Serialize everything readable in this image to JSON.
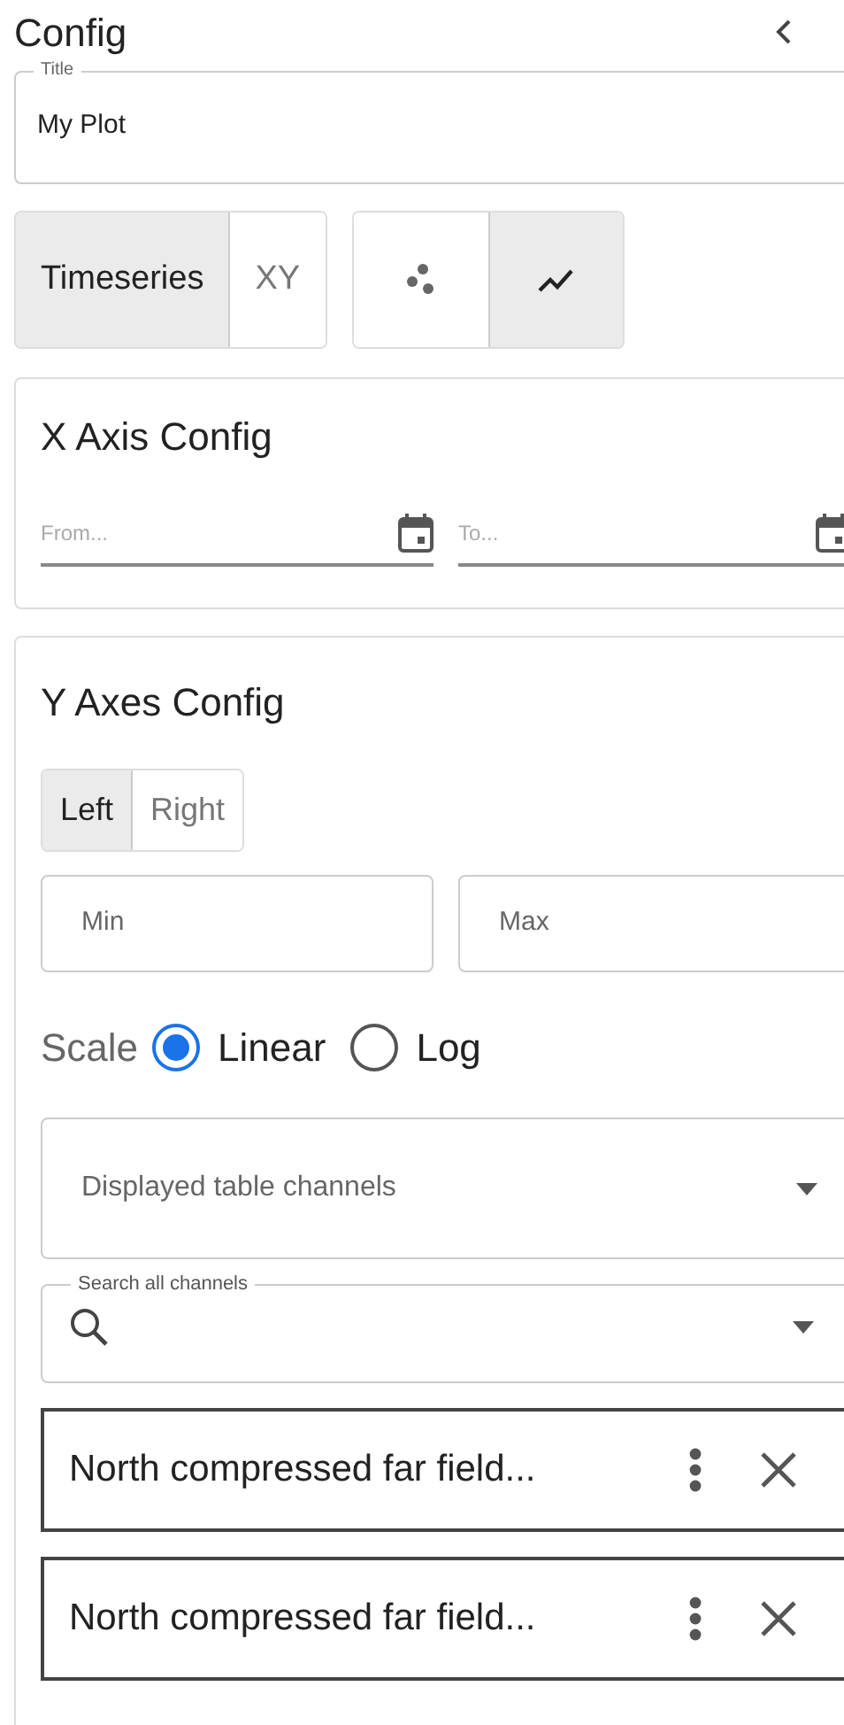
{
  "header": {
    "title": "Config"
  },
  "title_field": {
    "label": "Title",
    "value": "My Plot"
  },
  "plot_types": [
    {
      "label": "Timeseries",
      "selected": true
    },
    {
      "label": "XY",
      "selected": false
    }
  ],
  "plot_styles": [
    {
      "kind": "scatter",
      "selected": false
    },
    {
      "kind": "line",
      "selected": true
    }
  ],
  "x_axis": {
    "title": "X Axis Config",
    "from": {
      "placeholder": "From..."
    },
    "to": {
      "placeholder": "To..."
    }
  },
  "y_axes": {
    "title": "Y Axes Config",
    "sides": [
      {
        "label": "Left",
        "selected": true
      },
      {
        "label": "Right",
        "selected": false
      }
    ],
    "min": {
      "placeholder": "Min"
    },
    "max": {
      "placeholder": "Max"
    },
    "scale": {
      "label": "Scale",
      "options": [
        {
          "label": "Linear",
          "selected": true
        },
        {
          "label": "Log",
          "selected": false
        }
      ]
    },
    "displayed_channels": {
      "placeholder": "Displayed table channels"
    },
    "search": {
      "label": "Search all channels"
    },
    "channels": [
      {
        "name": "North compressed far field..."
      },
      {
        "name": "North compressed far field..."
      }
    ]
  }
}
